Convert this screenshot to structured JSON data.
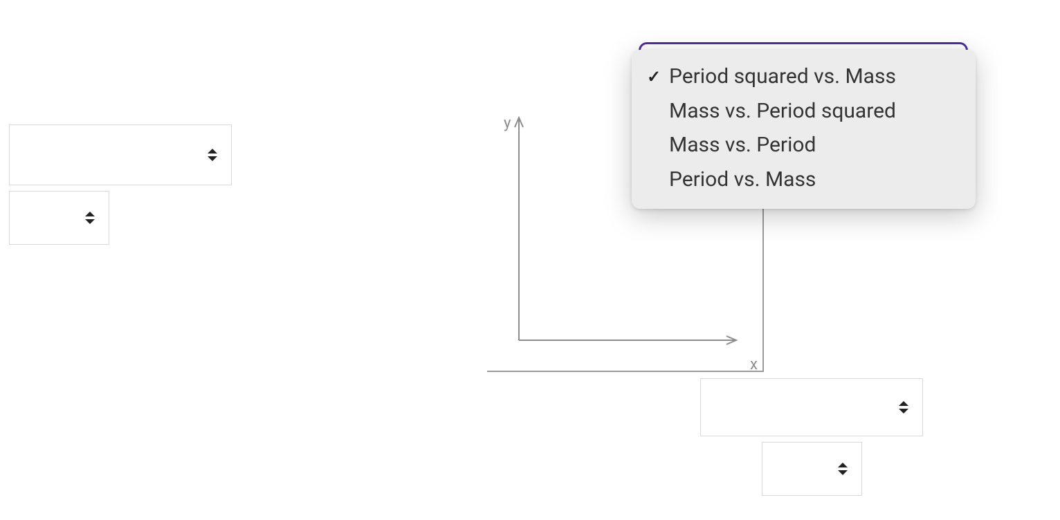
{
  "selects": {
    "top_left_large": {
      "value": ""
    },
    "top_left_small": {
      "value": ""
    },
    "bottom_right_large": {
      "value": ""
    },
    "bottom_right_small": {
      "value": ""
    }
  },
  "graph": {
    "y_label": "y",
    "x_label": "x"
  },
  "dropdown": {
    "selected_index": 0,
    "items": [
      {
        "label": ""
      },
      {
        "label": "Period squared vs. Mass"
      },
      {
        "label": "Mass vs. Period squared"
      },
      {
        "label": "Mass vs. Period"
      },
      {
        "label": "Period vs. Mass"
      }
    ]
  }
}
